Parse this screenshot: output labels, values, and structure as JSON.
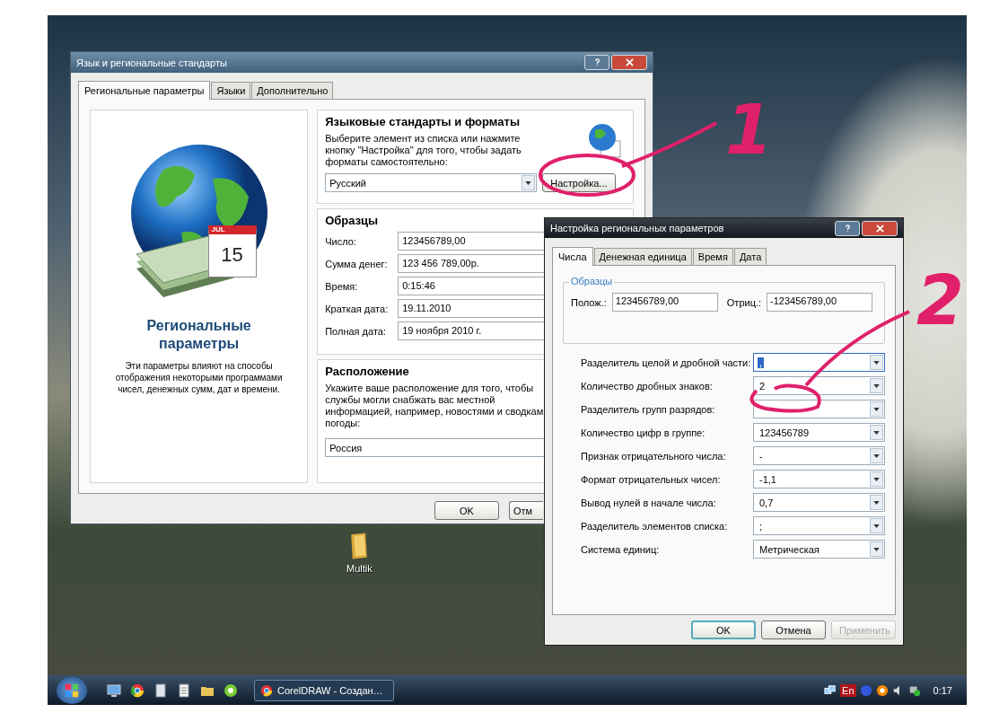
{
  "desktop": {
    "icons": [
      {
        "label": "Multik"
      }
    ]
  },
  "dialog_main": {
    "title": "Язык и региональные стандарты",
    "tabs": [
      {
        "label": "Региональные параметры",
        "selected": true
      },
      {
        "label": "Языки",
        "selected": false
      },
      {
        "label": "Дополнительно",
        "selected": false
      }
    ],
    "intro": {
      "calendar_month": "JUL",
      "calendar_day": "15",
      "heading": "Региональные параметры",
      "text": "Эти параметры влияют на способы отображения некоторыми программами чисел, денежных сумм, дат и времени."
    },
    "formats": {
      "heading": "Языковые стандарты и форматы",
      "text": "Выберите элемент из списка или нажмите кнопку \"Настройка\" для того, чтобы задать форматы самостоятельно:",
      "selection": "Русский",
      "button": "Настройка..."
    },
    "samples": {
      "heading": "Образцы",
      "rows": [
        {
          "label": "Число:",
          "value": "123456789,00"
        },
        {
          "label": "Сумма денег:",
          "value": "123 456 789,00р."
        },
        {
          "label": "Время:",
          "value": "0:15:46"
        },
        {
          "label": "Краткая дата:",
          "value": "19.11.2010"
        },
        {
          "label": "Полная дата:",
          "value": "19 ноября 2010 г."
        }
      ]
    },
    "location": {
      "heading": "Расположение",
      "text": "Укажите ваше расположение для того, чтобы службы могли снабжать вас местной информацией, например, новостями и сводкам погоды:",
      "selection": "Россия"
    },
    "buttons": [
      {
        "label": "OK"
      },
      {
        "label": "Отм"
      }
    ]
  },
  "dialog_custom": {
    "title": "Настройка региональных параметров",
    "tabs": [
      {
        "label": "Числа",
        "selected": true
      },
      {
        "label": "Денежная единица",
        "selected": false
      },
      {
        "label": "Время",
        "selected": false
      },
      {
        "label": "Дата",
        "selected": false
      }
    ],
    "samples": {
      "heading": "Образцы",
      "positive_label": "Полож.:",
      "positive_value": "123456789,00",
      "negative_label": "Отриц.:",
      "negative_value": "-123456789,00"
    },
    "settings": [
      {
        "label": "Разделитель целой и дробной части:",
        "value": ",",
        "focused": true
      },
      {
        "label": "Количество дробных знаков:",
        "value": "2",
        "focused": false
      },
      {
        "label": "Разделитель групп разрядов:",
        "focused": false
      },
      {
        "label": "Количество цифр в группе:",
        "value": "123456789",
        "focused": false
      },
      {
        "label": "Признак отрицательного числа:",
        "value": "-",
        "focused": false
      },
      {
        "label": "Формат отрицательных чисел:",
        "value": "-1,1",
        "focused": false
      },
      {
        "label": "Вывод нулей в начале числа:",
        "value": "0,7",
        "focused": false
      },
      {
        "label": "Разделитель элементов списка:",
        "value": ";",
        "focused": false
      },
      {
        "label": "Система единиц:",
        "value": "Метрическая",
        "focused": false
      }
    ],
    "buttons": [
      {
        "label": "OK",
        "default": true,
        "disabled": false
      },
      {
        "label": "Отмена",
        "default": false,
        "disabled": false
      },
      {
        "label": "Применить",
        "default": false,
        "disabled": true
      }
    ]
  },
  "annotations": [
    {
      "text": "1",
      "color": "#e0206a"
    },
    {
      "text": "2",
      "color": "#e0206a"
    }
  ],
  "taskbar": {
    "task": {
      "label": "CorelDRAW - Создан…"
    },
    "language": "En",
    "clock": "0:17"
  }
}
